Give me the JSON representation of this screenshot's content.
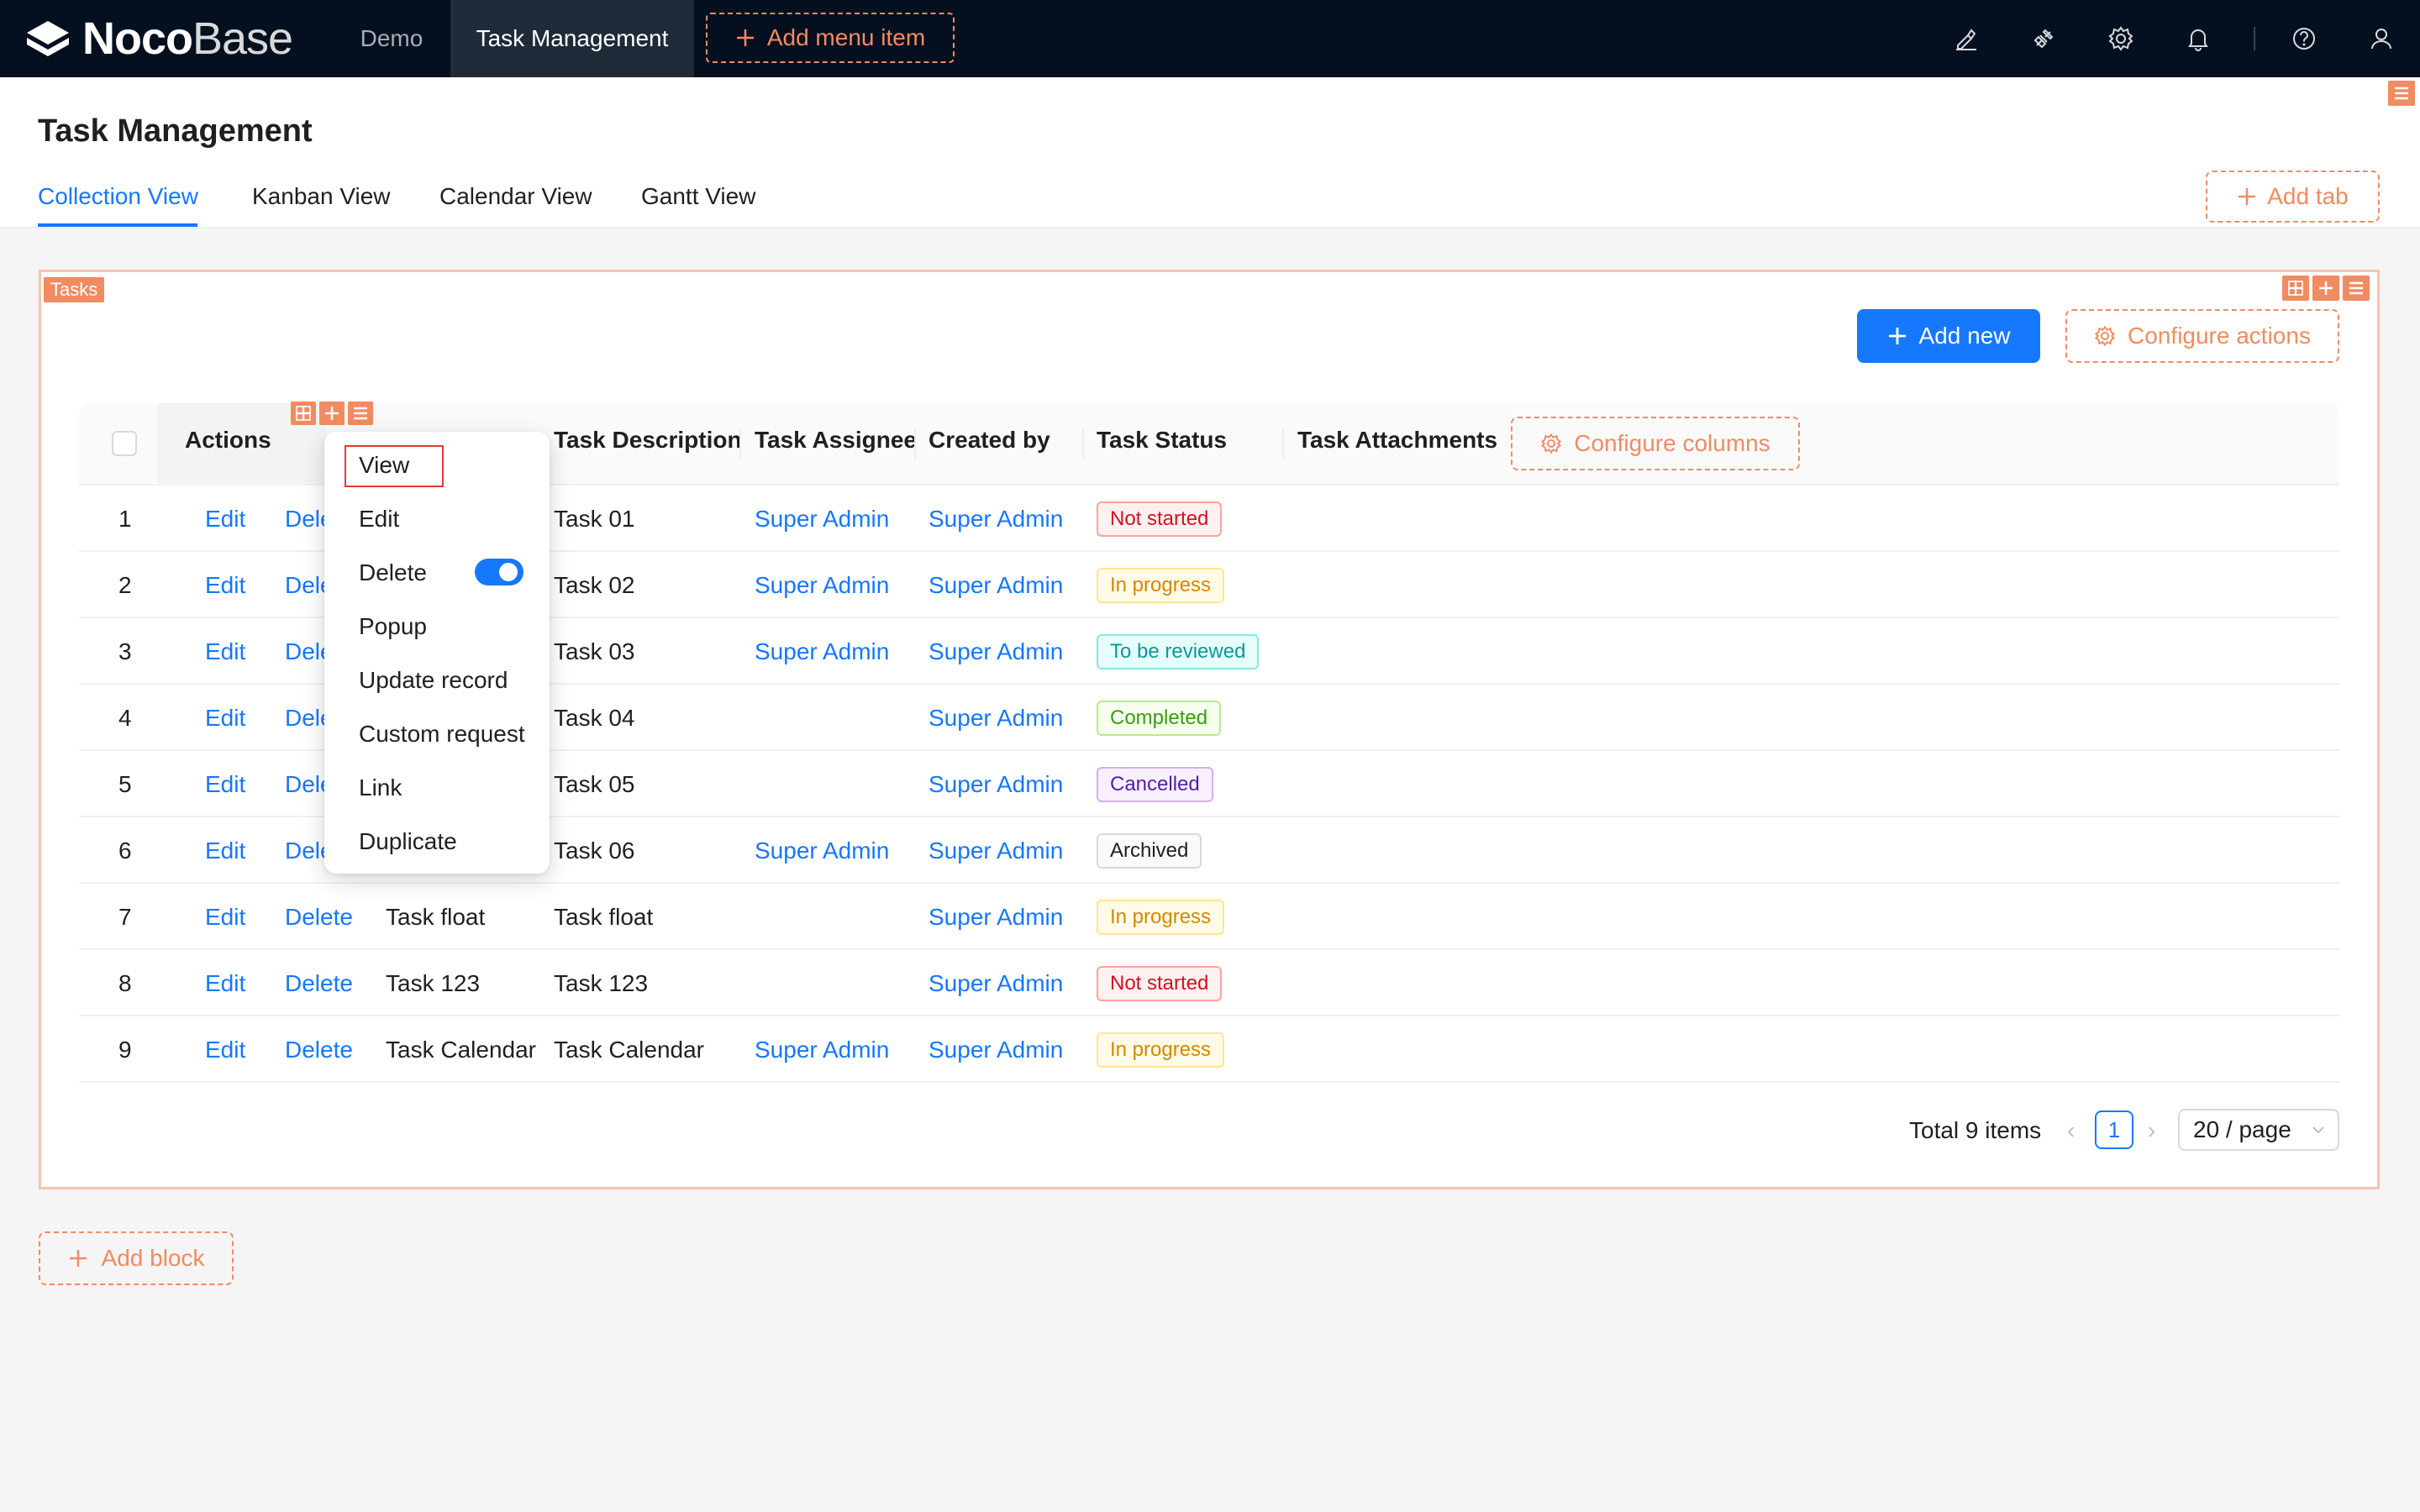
{
  "brand": {
    "bold": "Noco",
    "light": "Base"
  },
  "nav": {
    "items": [
      {
        "label": "Demo"
      },
      {
        "label": "Task Management"
      }
    ],
    "add_menu_label": "Add menu item"
  },
  "page": {
    "title": "Task Management",
    "tabs": [
      {
        "label": "Collection View"
      },
      {
        "label": "Kanban View"
      },
      {
        "label": "Calendar View"
      },
      {
        "label": "Gantt View"
      }
    ],
    "add_tab_label": "Add tab"
  },
  "block": {
    "tag": "Tasks",
    "add_new_label": "Add new",
    "configure_actions_label": "Configure actions",
    "configure_columns_label": "Configure columns",
    "columns": [
      "Actions",
      "Task Description",
      "Task Assignee",
      "Created by",
      "Task Status",
      "Task Attachments"
    ],
    "rows": [
      {
        "num": "1",
        "edit": "Edit",
        "delete": "Dele",
        "name": "",
        "desc": "Task 01",
        "assignee": "Super Admin",
        "created_by": "Super Admin",
        "status": "Not started"
      },
      {
        "num": "2",
        "edit": "Edit",
        "delete": "Dele",
        "name": "",
        "desc": "Task 02",
        "assignee": "Super Admin",
        "created_by": "Super Admin",
        "status": "In progress"
      },
      {
        "num": "3",
        "edit": "Edit",
        "delete": "Dele",
        "name": "",
        "desc": "Task 03",
        "assignee": "Super Admin",
        "created_by": "Super Admin",
        "status": "To be reviewed"
      },
      {
        "num": "4",
        "edit": "Edit",
        "delete": "Dele",
        "name": "",
        "desc": "Task 04",
        "assignee": "",
        "created_by": "Super Admin",
        "status": "Completed"
      },
      {
        "num": "5",
        "edit": "Edit",
        "delete": "Dele",
        "name": "",
        "desc": "Task 05",
        "assignee": "",
        "created_by": "Super Admin",
        "status": "Cancelled"
      },
      {
        "num": "6",
        "edit": "Edit",
        "delete": "Dele",
        "name": "",
        "desc": "Task 06",
        "assignee": "Super Admin",
        "created_by": "Super Admin",
        "status": "Archived"
      },
      {
        "num": "7",
        "edit": "Edit",
        "delete": "Delete",
        "name": "Task float",
        "desc": "Task float",
        "assignee": "",
        "created_by": "Super Admin",
        "status": "In progress"
      },
      {
        "num": "8",
        "edit": "Edit",
        "delete": "Delete",
        "name": "Task 123",
        "desc": "Task 123",
        "assignee": "",
        "created_by": "Super Admin",
        "status": "Not started"
      },
      {
        "num": "9",
        "edit": "Edit",
        "delete": "Delete",
        "name": "Task Calendar",
        "desc": "Task Calendar",
        "assignee": "Super Admin",
        "created_by": "Super Admin",
        "status": "In progress"
      }
    ],
    "pagination": {
      "total": "Total 9 items",
      "current": "1",
      "page_size": "20 / page"
    }
  },
  "status_colors": {
    "Not started": {
      "color": "#cf1322",
      "bg": "#fff1f0",
      "border": "#ffa39e"
    },
    "In progress": {
      "color": "#d48806",
      "bg": "#fffbe6",
      "border": "#ffe58f"
    },
    "To be reviewed": {
      "color": "#08979c",
      "bg": "#e6fffb",
      "border": "#87e8de"
    },
    "Completed": {
      "color": "#389e0d",
      "bg": "#f6ffed",
      "border": "#b7eb8f"
    },
    "Cancelled": {
      "color": "#531dab",
      "bg": "#f9f0ff",
      "border": "#d3adf7"
    },
    "Archived": {
      "color": "#1f1f1f",
      "bg": "#fafafa",
      "border": "#d9d9d9"
    }
  },
  "dropdown": {
    "items": [
      "View",
      "Edit",
      "Delete",
      "Popup",
      "Update record",
      "Custom request",
      "Link",
      "Duplicate"
    ],
    "delete_toggle_on": true
  },
  "add_block_label": "Add block",
  "colors": {
    "primary": "#1677ff",
    "accent": "#f18b62",
    "topbar": "#041020"
  }
}
